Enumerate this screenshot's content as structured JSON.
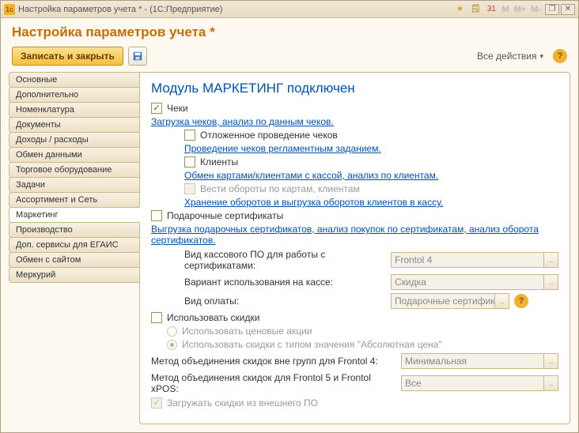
{
  "titlebar": {
    "title": "Настройка параметров учета * - (1С:Предприятие)"
  },
  "header": {
    "title": "Настройка параметров учета *"
  },
  "toolbar": {
    "save_close": "Записать и закрыть",
    "all_actions": "Все действия"
  },
  "tabs": [
    "Основные",
    "Дополнительно",
    "Номенклатура",
    "Документы",
    "Доходы / расходы",
    "Обмен данными",
    "Торговое оборудование",
    "Задачи",
    "Ассортимент и Сеть",
    "Маркетинг",
    "Производство",
    "Доп. сервисы для ЕГАИС",
    "Обмен с сайтом",
    "Меркурий"
  ],
  "active_tab": 9,
  "panel": {
    "heading": "Модуль МАРКЕТИНГ подключен",
    "checks_label": "Чеки",
    "checks_link": "Загрузка чеков, анализ по данным чеков.",
    "deferred_label": "Отложенное проведение чеков",
    "deferred_link": "Проведение чеков регламентным заданием.",
    "clients_label": "Клиенты",
    "clients_link": "Обмен картами/клиентами с кассой, анализ по клиентам.",
    "turnover_label": "Вести обороты по картам, клиентам",
    "turnover_link": "Хранение оборотов и выгрузка оборотов клиентов в кассу.",
    "gift_label": "Подарочные сертификаты",
    "gift_link": "Выгрузка подарочных сертификатов, анализ покупок по сертификатам, анализ оборота сертификатов.",
    "form": {
      "pos_type_label": "Вид кассового ПО для работы с сертификатами:",
      "pos_type_value": "Frontol 4",
      "variant_label": "Вариант использования на кассе:",
      "variant_value": "Скидка",
      "payment_label": "Вид оплаты:",
      "payment_value": "Подарочные сертификат"
    },
    "discounts_label": "Использовать скидки",
    "discount_radio1": "Использовать ценовые акции",
    "discount_radio2": "Использовать скидки с типом значения \"Абсолютная цена\"",
    "combine_out_label": "Метод объединения скидок вне групп для Frontol 4:",
    "combine_out_value": "Минимальная",
    "combine_f5_label": "Метод объединения скидок для Frontol 5 и Frontol xPOS:",
    "combine_f5_value": "Все",
    "load_ext_label": "Загружать скидки из внешнего ПО"
  }
}
